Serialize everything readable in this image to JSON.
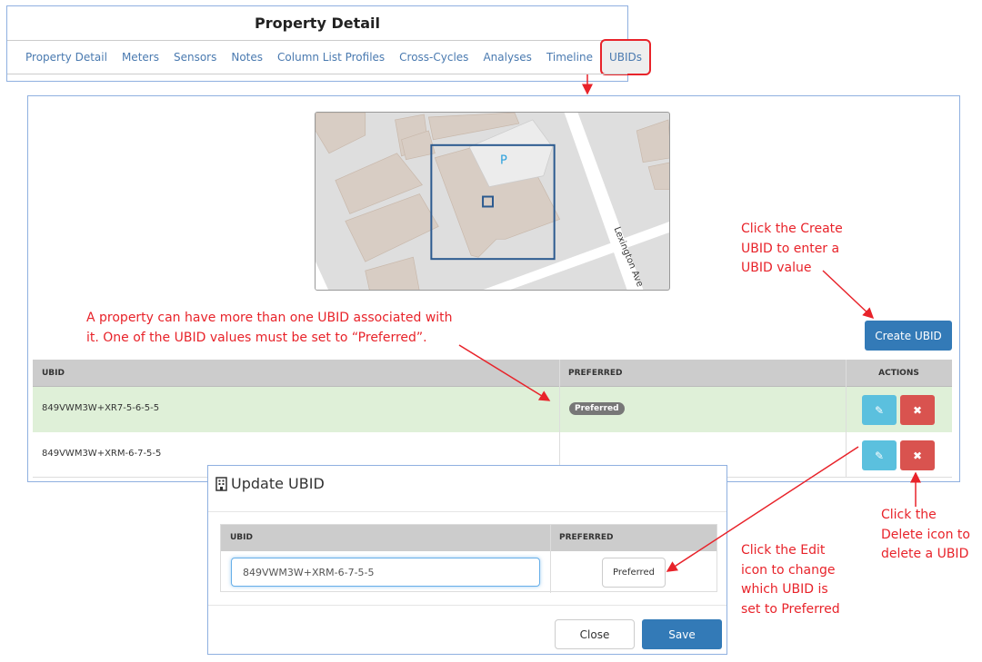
{
  "header": {
    "title": "Property Detail"
  },
  "tabs": [
    {
      "label": "Property Detail"
    },
    {
      "label": "Meters"
    },
    {
      "label": "Sensors"
    },
    {
      "label": "Notes"
    },
    {
      "label": "Column List Profiles"
    },
    {
      "label": "Cross-Cycles"
    },
    {
      "label": "Analyses"
    },
    {
      "label": "Timeline"
    },
    {
      "label": "UBIDs",
      "active": true
    }
  ],
  "map": {
    "parking_label": "P",
    "street_label": "Lexington Ave"
  },
  "create_button": "Create UBID",
  "table": {
    "headers": [
      "UBID",
      "PREFERRED",
      "ACTIONS"
    ],
    "rows": [
      {
        "ubid": "849VWM3W+XR7-5-6-5-5",
        "preferred": "Preferred"
      },
      {
        "ubid": "849VWM3W+XRM-6-7-5-5",
        "preferred": ""
      }
    ]
  },
  "modal": {
    "title": "Update UBID",
    "icon": "building-icon",
    "headers": [
      "UBID",
      "PREFERRED"
    ],
    "ubid_value": "849VWM3W+XRM-6-7-5-5",
    "preferred_button": "Preferred",
    "close": "Close",
    "save": "Save"
  },
  "annotations": {
    "create": [
      "Click the Create",
      "UBID to enter a",
      "UBID value"
    ],
    "property": [
      "A property can have more than one UBID associated with",
      "it. One of the UBID values must be set to “Preferred”."
    ],
    "delete": [
      "Click the",
      "Delete icon to",
      "delete a UBID"
    ],
    "edit": [
      "Click the Edit",
      "icon to change",
      "which UBID is",
      "set to Preferred"
    ]
  },
  "colors": {
    "primary": "#337ab7",
    "info": "#5bc0de",
    "danger": "#d9534f",
    "success_row": "#dff0d8",
    "annotation": "#e8232a"
  }
}
